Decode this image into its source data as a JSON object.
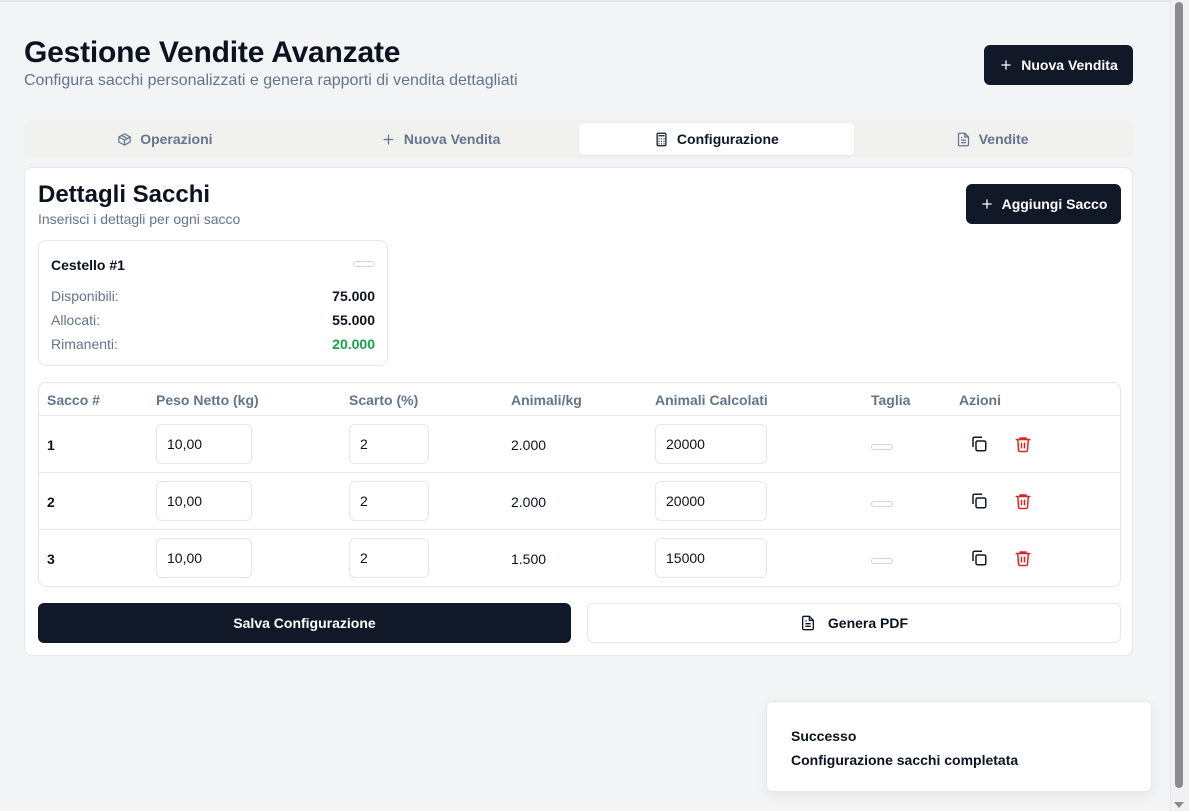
{
  "header": {
    "title": "Gestione Vendite Avanzate",
    "subtitle": "Configura sacchi personalizzati e genera rapporti di vendita dettagliati",
    "new_sale_button": "Nuova Vendita"
  },
  "tabs": [
    {
      "label": "Operazioni",
      "icon": "package-icon",
      "active": false
    },
    {
      "label": "Nuova Vendita",
      "icon": "plus-icon",
      "active": false
    },
    {
      "label": "Configurazione",
      "icon": "calculator-icon",
      "active": true
    },
    {
      "label": "Vendite",
      "icon": "file-text-icon",
      "active": false
    }
  ],
  "card": {
    "title": "Dettagli Sacchi",
    "subtitle": "Inserisci i dettagli per ogni sacco",
    "add_sack_button": "Aggiungi Sacco"
  },
  "basket": {
    "name": "Cestello #1",
    "available_label": "Disponibili:",
    "available_value": "75.000",
    "allocated_label": "Allocati:",
    "allocated_value": "55.000",
    "remaining_label": "Rimanenti:",
    "remaining_value": "20.000"
  },
  "table": {
    "headers": [
      "Sacco #",
      "Peso Netto (kg)",
      "Scarto (%)",
      "Animali/kg",
      "Animali Calcolati",
      "Taglia",
      "Azioni"
    ],
    "rows": [
      {
        "sack": "1",
        "net_weight": "10,00",
        "waste": "2",
        "animals_per_kg": "2.000",
        "animals_calc": "20000"
      },
      {
        "sack": "2",
        "net_weight": "10,00",
        "waste": "2",
        "animals_per_kg": "2.000",
        "animals_calc": "20000"
      },
      {
        "sack": "3",
        "net_weight": "10,00",
        "waste": "2",
        "animals_per_kg": "1.500",
        "animals_calc": "15000"
      }
    ]
  },
  "actions": {
    "save_button": "Salva Configurazione",
    "pdf_button": "Genera PDF"
  },
  "toast": {
    "title": "Successo",
    "description": "Configurazione sacchi completata"
  },
  "colors": {
    "primary_dark": "#111827",
    "success_green": "#16a34a",
    "danger_red": "#dc2626"
  }
}
